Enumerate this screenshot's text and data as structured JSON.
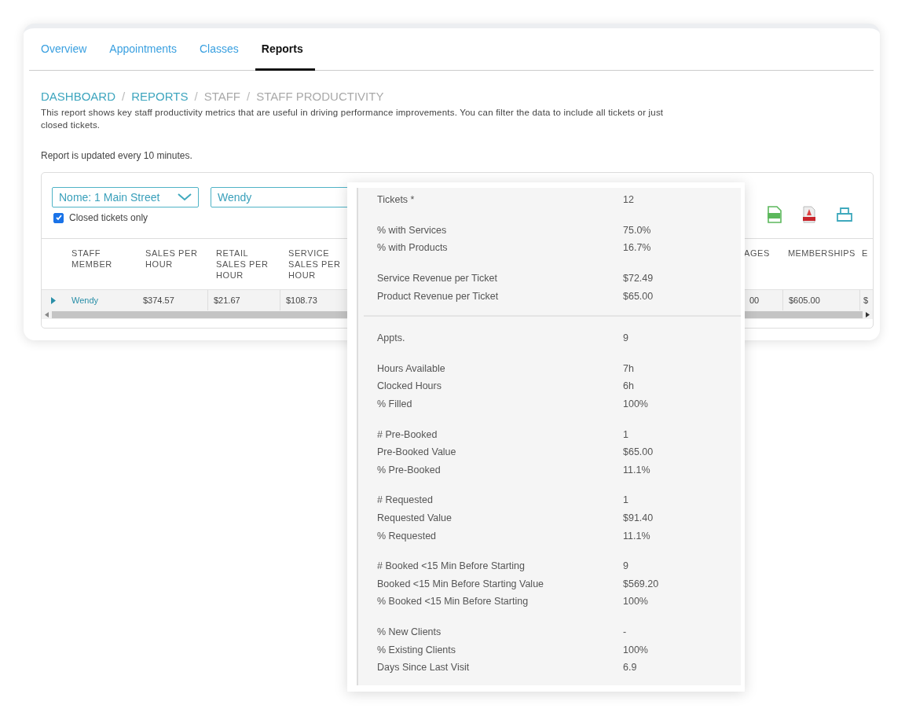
{
  "tabs": [
    {
      "label": "Overview",
      "selected": false
    },
    {
      "label": "Appointments",
      "selected": false
    },
    {
      "label": "Classes",
      "selected": false
    },
    {
      "label": "Reports",
      "selected": true
    }
  ],
  "breadcrumb": [
    {
      "label": "DASHBOARD",
      "link": true,
      "separator": "/"
    },
    {
      "label": "REPORTS",
      "link": true,
      "separator": "/"
    },
    {
      "label": "STAFF",
      "link": false,
      "separator": "/"
    },
    {
      "label": "STAFF PRODUCTIVITY",
      "link": false
    }
  ],
  "description": "This report shows key staff productivity metrics that are useful in driving performance improvements. You can filter the data to include all tickets or just closed tickets.",
  "update_note": "Report is updated every 10 minutes.",
  "filters": {
    "location": "Nome: 1 Main Street",
    "staff": "Wendy",
    "closed_only": {
      "label": "Closed tickets only",
      "checked": true
    }
  },
  "table": {
    "columns": [
      "STAFF MEMBER",
      "SALES PER HOUR",
      "RETAIL SALES PER HOUR",
      "SERVICE SALES PER HOUR",
      "AGES",
      "MEMBERSHIPS",
      "E"
    ],
    "rows": [
      {
        "cells": [
          "Wendy",
          "$374.57",
          "$21.67",
          "$108.73",
          "00",
          "$605.00",
          "$"
        ]
      }
    ]
  },
  "details": [
    {
      "groups": [
        [
          {
            "label": "Tickets *",
            "value": "12"
          }
        ],
        [
          {
            "label": "% with Services",
            "value": "75.0%"
          },
          {
            "label": "% with Products",
            "value": "16.7%"
          }
        ],
        [
          {
            "label": "Service Revenue per Ticket",
            "value": "$72.49"
          },
          {
            "label": "Product Revenue per Ticket",
            "value": "$65.00"
          }
        ]
      ]
    },
    {
      "groups": [
        [
          {
            "label": "Appts.",
            "value": "9"
          }
        ],
        [
          {
            "label": "Hours Available",
            "value": "7h"
          },
          {
            "label": "Clocked Hours",
            "value": "6h"
          },
          {
            "label": "% Filled",
            "value": "100%"
          }
        ],
        [
          {
            "label": "# Pre-Booked",
            "value": "1"
          },
          {
            "label": "Pre-Booked Value",
            "value": "$65.00"
          },
          {
            "label": "% Pre-Booked",
            "value": "11.1%"
          }
        ],
        [
          {
            "label": "# Requested",
            "value": "1"
          },
          {
            "label": "Requested Value",
            "value": "$91.40"
          },
          {
            "label": "% Requested",
            "value": "11.1%"
          }
        ],
        [
          {
            "label": "# Booked <15 Min Before Starting",
            "value": "9"
          },
          {
            "label": "Booked <15 Min Before Starting Value",
            "value": "$569.20"
          },
          {
            "label": "% Booked <15 Min Before Starting",
            "value": "100%"
          }
        ],
        [
          {
            "label": "% New Clients",
            "value": "-"
          },
          {
            "label": "% Existing Clients",
            "value": "100%"
          },
          {
            "label": "Days Since Last Visit",
            "value": "6.9"
          }
        ]
      ]
    }
  ]
}
